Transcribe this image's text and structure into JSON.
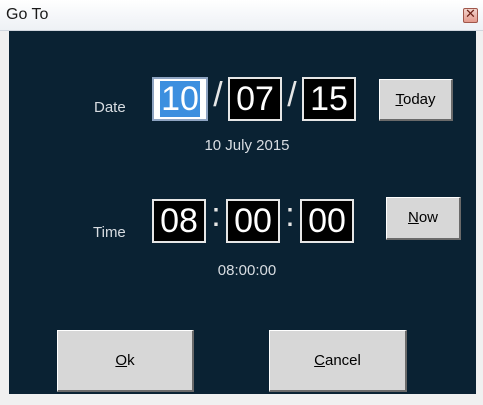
{
  "window": {
    "title": "Go To",
    "close_glyph": "✕"
  },
  "date": {
    "label": "Date",
    "day": "10",
    "month": "07",
    "year": "15",
    "separator": "/",
    "readout": "10 July 2015",
    "today_accel": "T",
    "today_rest": "oday"
  },
  "time": {
    "label": "Time",
    "hours": "08",
    "minutes": "00",
    "seconds": "00",
    "separator": ":",
    "readout": "08:00:00",
    "now_accel": "N",
    "now_rest": "ow"
  },
  "actions": {
    "ok_accel": "O",
    "ok_rest": "k",
    "cancel_accel": "C",
    "cancel_rest": "ancel"
  },
  "colors": {
    "dialog_background": "#0a2233",
    "selection": "#3c8fdf"
  }
}
